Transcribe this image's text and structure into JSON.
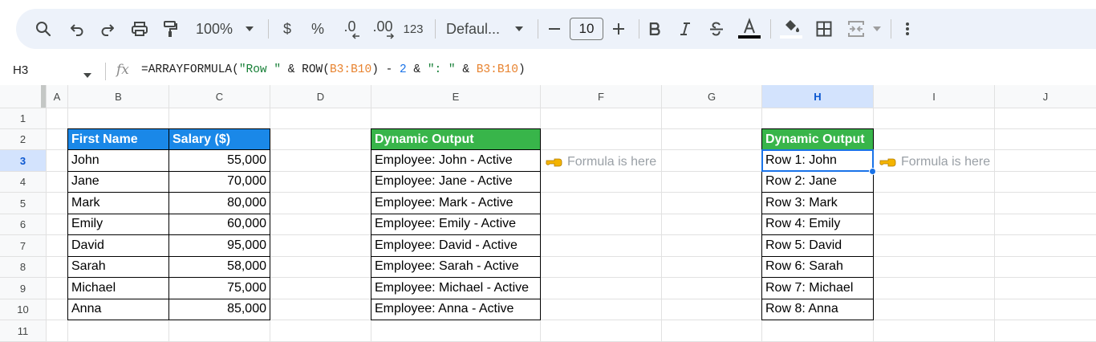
{
  "toolbar": {
    "zoom": "100%",
    "currency": "$",
    "percent": "%",
    "decrease_decimals": ".0",
    "increase_decimals": ".00",
    "number_format": "123",
    "font_name": "Defaul...",
    "font_size": "10",
    "text_color_bar": "#000000",
    "fill_color_bar": "#ffffff"
  },
  "formula_bar": {
    "cell_ref": "H3",
    "formula_parts": {
      "p1": "=ARRAYFORMULA(",
      "p2": "\"Row \"",
      "p3": " & ROW(",
      "p4": "B3:B10",
      "p5": ") - ",
      "p6": "2",
      "p7": " & ",
      "p8": "\": \"",
      "p9": " & ",
      "p10": "B3:B10",
      "p11": ")"
    }
  },
  "columns": [
    "A",
    "B",
    "C",
    "D",
    "E",
    "F",
    "G",
    "H",
    "I",
    "J"
  ],
  "rows": [
    "1",
    "2",
    "3",
    "4",
    "5",
    "6",
    "7",
    "8",
    "9",
    "10",
    "11"
  ],
  "selected_column": "H",
  "selected_row": "3",
  "table_salary": {
    "headers": [
      "First Name",
      "Salary ($)"
    ],
    "rows": [
      [
        "John",
        "55,000"
      ],
      [
        "Jane",
        "70,000"
      ],
      [
        "Mark",
        "80,000"
      ],
      [
        "Emily",
        "60,000"
      ],
      [
        "David",
        "95,000"
      ],
      [
        "Sarah",
        "58,000"
      ],
      [
        "Michael",
        "75,000"
      ],
      [
        "Anna",
        "85,000"
      ]
    ]
  },
  "table_output_e": {
    "header": "Dynamic Output",
    "rows": [
      "Employee: John - Active",
      "Employee: Jane - Active",
      "Employee: Mark - Active",
      "Employee: Emily - Active",
      "Employee: David - Active",
      "Employee: Sarah - Active",
      "Employee: Michael - Active",
      "Employee: Anna - Active"
    ],
    "note": "Formula is here"
  },
  "table_output_h": {
    "header": "Dynamic Output",
    "rows": [
      "Row 1: John",
      "Row 2: Jane",
      "Row 3: Mark",
      "Row 4: Emily",
      "Row 5: David",
      "Row 6: Sarah",
      "Row 7: Michael",
      "Row 8: Anna"
    ],
    "note": "Formula is here"
  },
  "colors": {
    "header_blue": "#1a88e8",
    "header_green": "#38b54a",
    "selection": "#1a73e8",
    "note_hand": "#f4b400"
  },
  "icons": {
    "note_pointer": "backhand-index-pointing-left-icon"
  }
}
